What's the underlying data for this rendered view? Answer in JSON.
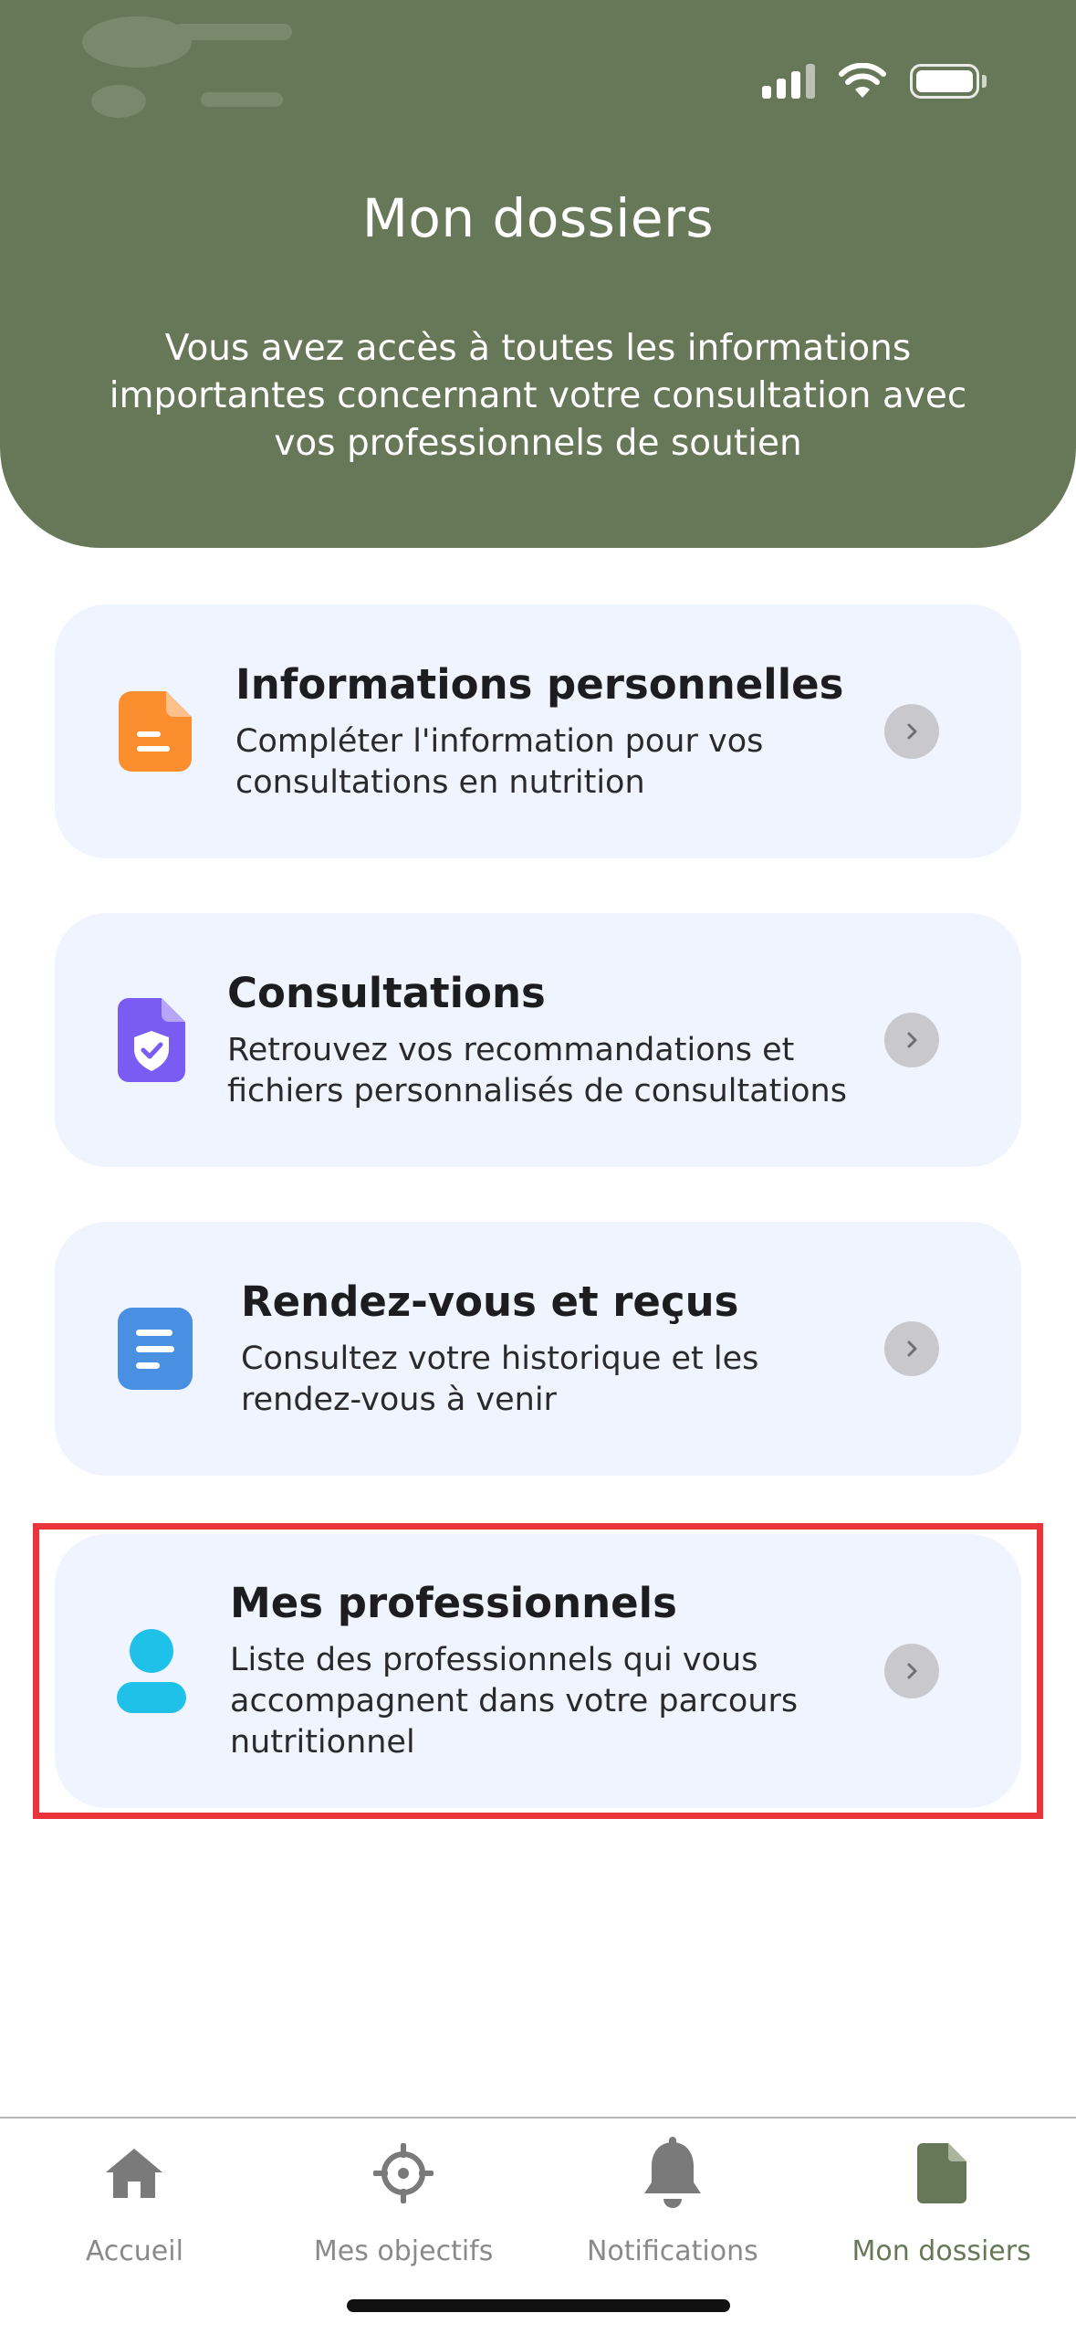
{
  "header": {
    "title": "Mon dossiers",
    "subtitle": "Vous avez accès à toutes les informations importantes concernant votre consultation avec vos professionnels de soutien",
    "color": "#677858"
  },
  "cards": [
    {
      "title": "Informations personnelles",
      "description": "Compléter l'information pour vos consultations en nutrition",
      "icon": "document-icon",
      "icon_color": "#fb8e2e"
    },
    {
      "title": "Consultations",
      "description": "Retrouvez vos recommandations et fichiers personnalisés de consultations",
      "icon": "shield-document-icon",
      "icon_color": "#7b5cf2"
    },
    {
      "title": "Rendez-vous et reçus",
      "description": "Consultez votre historique et les rendez-vous à venir",
      "icon": "list-document-icon",
      "icon_color": "#4a90e2"
    },
    {
      "title": "Mes professionnels",
      "description": "Liste des professionnels qui vous accompagnent dans votre parcours nutritionnel",
      "icon": "person-icon",
      "icon_color": "#1fc1e8"
    }
  ],
  "tabs": [
    {
      "label": "Accueil",
      "icon": "home-icon"
    },
    {
      "label": "Mes objectifs",
      "icon": "target-icon"
    },
    {
      "label": "Notifications",
      "icon": "bell-icon"
    },
    {
      "label": "Mon dossiers",
      "icon": "file-icon",
      "active": true
    }
  ],
  "colors": {
    "card_bg": "#eff4fe",
    "highlight": "#e8343a",
    "inactive_tab": "#8a8a8a"
  }
}
